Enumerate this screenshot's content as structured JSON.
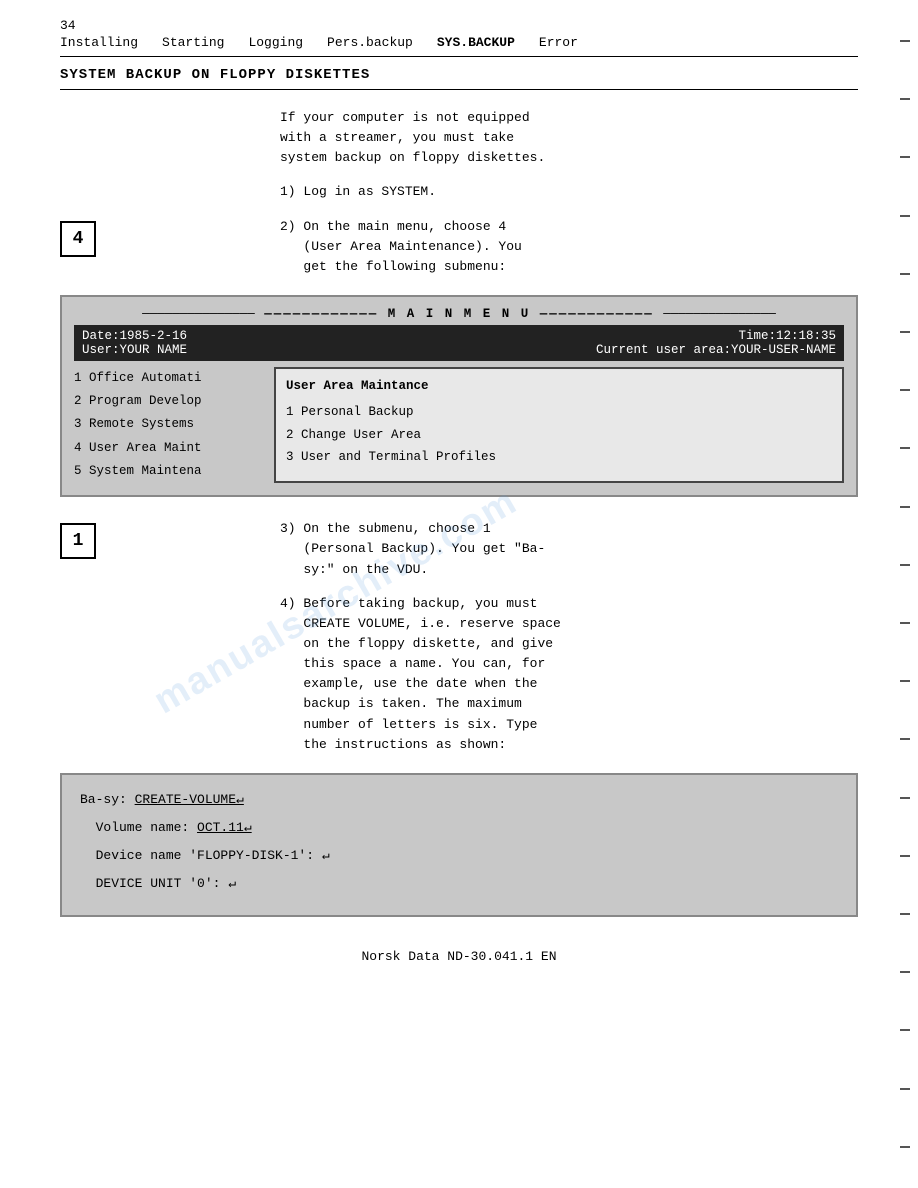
{
  "header": {
    "page_number": "34",
    "nav": [
      "Installing",
      "Starting",
      "Logging",
      "Pers.backup",
      "SYS.BACKUP",
      "Error"
    ],
    "nav_bold": "SYS.BACKUP"
  },
  "section_title": "SYSTEM BACKUP ON FLOPPY DISKETTES",
  "intro_text": "If your computer is not equipped\nwith a streamer, you must take\nsystem backup on floppy diskettes.",
  "steps": [
    {
      "step": "1) Log in as SYSTEM."
    },
    {
      "step": "2) On the main menu, choose 4\n   (User Area Maintenance). You\n   get the following submenu:"
    }
  ],
  "box_label_4": "4",
  "menu_screen": {
    "title": "M A I N   M E N U",
    "header_left1": "Date:1985-2-16",
    "header_left2": "User:YOUR NAME",
    "header_right1": "Time:12:18:35",
    "header_right2": "Current user area:YOUR-USER-NAME",
    "menu_items": [
      "1 Office Automati",
      "2 Program Develop",
      "3 Remote Systems",
      "4 User Area Maint",
      "5 System Maintena"
    ],
    "submenu_title": "User Area Maintance",
    "submenu_items": [
      "1 Personal Backup",
      "2 Change User Area",
      "3 User and Terminal Profiles"
    ]
  },
  "box_label_1": "1",
  "step3_text": "3) On the submenu, choose 1\n   (Personal Backup). You get \"Ba-\n   sy:\" on the VDU.",
  "step4_text": "4) Before taking backup, you must\n   CREATE VOLUME, i.e. reserve space\n   on the floppy diskette, and give\n   this space a name. You can, for\n   example, use the date when the\n   backup is taken. The maximum\n   number of letters is six. Type\n   the instructions as shown:",
  "terminal": {
    "lines": [
      {
        "label": "Ba-sy: ",
        "value": "CREATE-VOLUME↵",
        "underline": true
      },
      {
        "label": "Volume name: ",
        "value": "OCT.11↵",
        "underline": true
      },
      {
        "label": "Device name 'FLOPPY-DISK-1': ",
        "value": "↵",
        "underline": false
      },
      {
        "label": "DEVICE UNIT '0': ",
        "value": "↵",
        "underline": false
      }
    ]
  },
  "footer": "Norsk Data ND-30.041.1 EN",
  "watermark": "manualsarchive.com"
}
